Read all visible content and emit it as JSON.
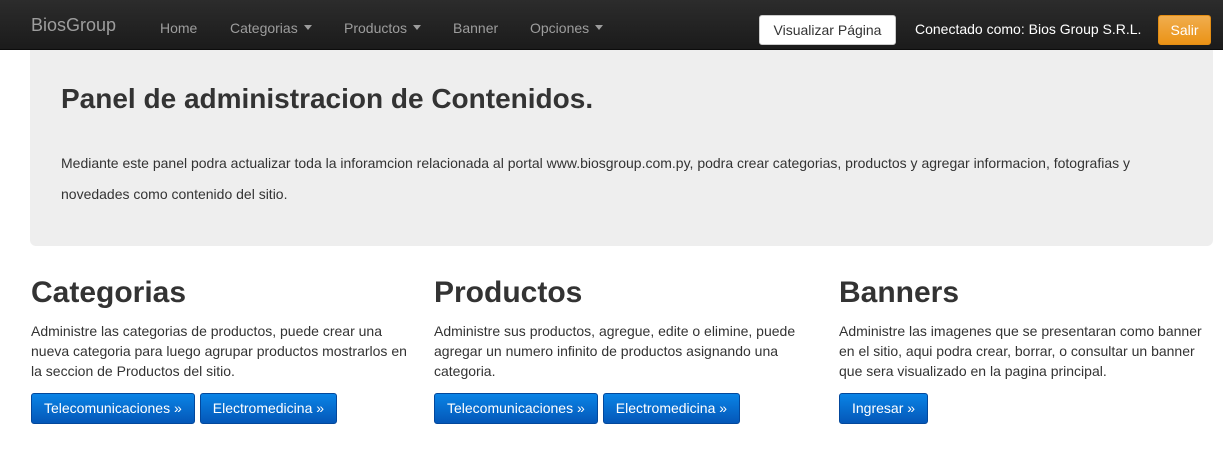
{
  "navbar": {
    "brand": "BiosGroup",
    "items": [
      {
        "label": "Home",
        "dropdown": false
      },
      {
        "label": "Categorias",
        "dropdown": true
      },
      {
        "label": "Productos",
        "dropdown": true
      },
      {
        "label": "Banner",
        "dropdown": false
      },
      {
        "label": "Opciones",
        "dropdown": true
      }
    ],
    "view_button": "Visualizar Página",
    "status": "Conectado como: Bios Group S.R.L.",
    "exit_button": "Salir"
  },
  "jumbotron": {
    "title": "Panel de administracion de Contenidos.",
    "text": "Mediante este panel podra actualizar toda la inforamcion relacionada al portal www.biosgroup.com.py, podra crear categorias, productos y agregar informacion, fotografias y novedades como contenido del sitio."
  },
  "sections": [
    {
      "title": "Categorias",
      "text": "Administre las categorias de productos, puede crear una nueva categoria para luego agrupar productos mostrarlos en la seccion de Productos del sitio.",
      "buttons": [
        "Telecomunicaciones »",
        "Electromedicina »"
      ]
    },
    {
      "title": "Productos",
      "text": "Administre sus productos, agregue, edite o elimine, puede agregar un numero infinito de productos asignando una categoria.",
      "buttons": [
        "Telecomunicaciones »",
        "Electromedicina »"
      ]
    },
    {
      "title": "Banners",
      "text": "Administre las imagenes que se presentaran como banner en el sitio, aqui podra crear, borrar, o consultar un banner que sera visualizado en la pagina principal.",
      "buttons": [
        "Ingresar »"
      ]
    }
  ],
  "colors": {
    "navbar_bg": "#222222",
    "jumbotron_bg": "#eeeeee",
    "primary": "#0764c9",
    "warning": "#f0ad4e"
  }
}
